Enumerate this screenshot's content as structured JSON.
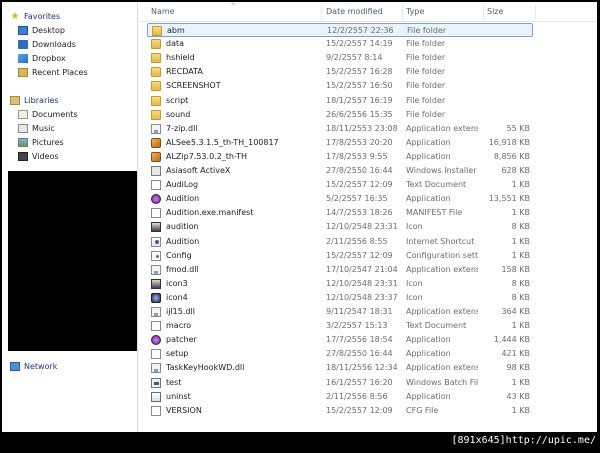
{
  "nav": {
    "favorites": "Favorites",
    "favorites_items": [
      "Desktop",
      "Downloads",
      "Dropbox",
      "Recent Places"
    ],
    "libraries": "Libraries",
    "libraries_items": [
      "Documents",
      "Music",
      "Pictures",
      "Videos"
    ],
    "network": "Network"
  },
  "columns": {
    "name": "Name",
    "date": "Date modified",
    "type": "Type",
    "size": "Size"
  },
  "files": [
    {
      "name": "abm",
      "date": "12/2/2557 22:36",
      "type": "File folder",
      "size": "",
      "icon": "folder"
    },
    {
      "name": "data",
      "date": "15/2/2557 14:19",
      "type": "File folder",
      "size": "",
      "icon": "folder"
    },
    {
      "name": "hshield",
      "date": "9/2/2557 8:14",
      "type": "File folder",
      "size": "",
      "icon": "folder"
    },
    {
      "name": "RECDATA",
      "date": "15/2/2557 16:28",
      "type": "File folder",
      "size": "",
      "icon": "folder"
    },
    {
      "name": "SCREENSHOT",
      "date": "15/2/2557 16:50",
      "type": "File folder",
      "size": "",
      "icon": "folder"
    },
    {
      "name": "script",
      "date": "18/1/2557 16:19",
      "type": "File folder",
      "size": "",
      "icon": "folder"
    },
    {
      "name": "sound",
      "date": "26/6/2556 15:35",
      "type": "File folder",
      "size": "",
      "icon": "folder"
    },
    {
      "name": "7-zip.dll",
      "date": "18/11/2553 23:08",
      "type": "Application extens...",
      "size": "55 KB",
      "icon": "dll"
    },
    {
      "name": "ALSee5.3.1.5_th-TH_100817",
      "date": "17/8/2553 20:20",
      "type": "Application",
      "size": "16,918 KB",
      "icon": "app"
    },
    {
      "name": "ALZip7.53.0.2_th-TH",
      "date": "17/8/2553 9:55",
      "type": "Application",
      "size": "8,856 KB",
      "icon": "app"
    },
    {
      "name": "Asiasoft ActiveX",
      "date": "27/8/2550 16:44",
      "type": "Windows Installer ...",
      "size": "628 KB",
      "icon": "msi"
    },
    {
      "name": "AudiLog",
      "date": "15/2/2557 12:09",
      "type": "Text Document",
      "size": "1 KB",
      "icon": "txt"
    },
    {
      "name": "Audition",
      "date": "5/2/2557 16:35",
      "type": "Application",
      "size": "13,551 KB",
      "icon": "purple"
    },
    {
      "name": "Audition.exe.manifest",
      "date": "14/7/2553 18:26",
      "type": "MANIFEST File",
      "size": "1 KB",
      "icon": "manifest"
    },
    {
      "name": "audition",
      "date": "12/10/2548 23:31",
      "type": "Icon",
      "size": "8 KB",
      "icon": "ico"
    },
    {
      "name": "Audition",
      "date": "2/11/2556 8:55",
      "type": "Internet Shortcut",
      "size": "1 KB",
      "icon": "url"
    },
    {
      "name": "Config",
      "date": "15/2/2557 12:09",
      "type": "Configuration sett...",
      "size": "1 KB",
      "icon": "cfg"
    },
    {
      "name": "fmod.dll",
      "date": "17/10/2547 21:04",
      "type": "Application extens...",
      "size": "158 KB",
      "icon": "dll"
    },
    {
      "name": "icon3",
      "date": "12/10/2548 23:31",
      "type": "Icon",
      "size": "8 KB",
      "icon": "ico"
    },
    {
      "name": "icon4",
      "date": "12/10/2548 23:37",
      "type": "Icon",
      "size": "8 KB",
      "icon": "ico2"
    },
    {
      "name": "ijl15.dll",
      "date": "9/11/2547 18:31",
      "type": "Application extens...",
      "size": "364 KB",
      "icon": "dll"
    },
    {
      "name": "macro",
      "date": "3/2/2557 15:13",
      "type": "Text Document",
      "size": "1 KB",
      "icon": "txt"
    },
    {
      "name": "patcher",
      "date": "17/7/2556 18:54",
      "type": "Application",
      "size": "1,444 KB",
      "icon": "purple"
    },
    {
      "name": "setup",
      "date": "27/8/2550 16:44",
      "type": "Application",
      "size": "421 KB",
      "icon": "gen"
    },
    {
      "name": "TaskKeyHookWD.dll",
      "date": "18/11/2556 12:34",
      "type": "Application extens...",
      "size": "98 KB",
      "icon": "dll"
    },
    {
      "name": "test",
      "date": "16/1/2557 16:20",
      "type": "Windows Batch File",
      "size": "1 KB",
      "icon": "bat"
    },
    {
      "name": "uninst",
      "date": "2/11/2556 8:56",
      "type": "Application",
      "size": "43 KB",
      "icon": "uninst"
    },
    {
      "name": "VERSION",
      "date": "15/2/2557 12:09",
      "type": "CFG File",
      "size": "1 KB",
      "icon": "txt"
    }
  ],
  "watermark": "[891x645]http://upic.me/"
}
